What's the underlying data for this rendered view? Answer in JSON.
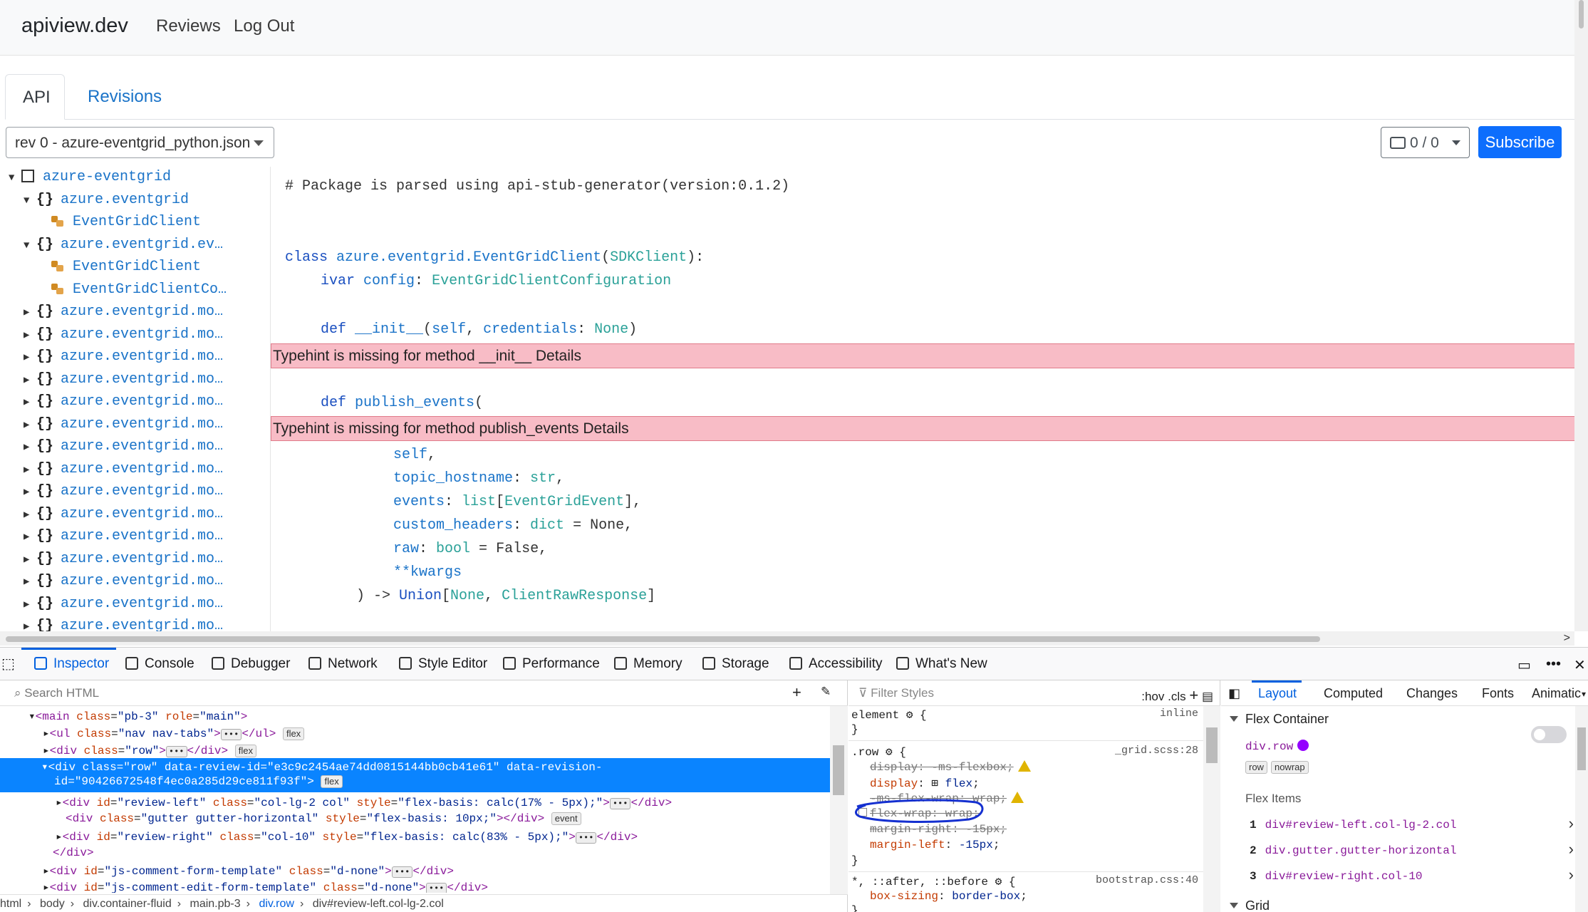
{
  "navbar": {
    "brand": "apiview.dev",
    "links": [
      "Reviews",
      "Log Out"
    ]
  },
  "tabs": [
    "API",
    "Revisions"
  ],
  "toolbar": {
    "revision_select": "rev 0 - azure-eventgrid_python.json",
    "comment_count": "0 / 0",
    "subscribe": "Subscribe"
  },
  "tree": {
    "root": "azure-eventgrid",
    "items": [
      {
        "kind": "ns",
        "label": "azure.eventgrid",
        "expanded": true
      },
      {
        "kind": "class",
        "label": "EventGridClient"
      },
      {
        "kind": "ns",
        "label": "azure.eventgrid.ev…",
        "expanded": true
      },
      {
        "kind": "class",
        "label": "EventGridClient"
      },
      {
        "kind": "class",
        "label": "EventGridClientCo…"
      },
      {
        "kind": "ns",
        "label": "azure.eventgrid.mo…"
      },
      {
        "kind": "ns",
        "label": "azure.eventgrid.mo…"
      },
      {
        "kind": "ns",
        "label": "azure.eventgrid.mo…"
      },
      {
        "kind": "ns",
        "label": "azure.eventgrid.mo…"
      },
      {
        "kind": "ns",
        "label": "azure.eventgrid.mo…"
      },
      {
        "kind": "ns",
        "label": "azure.eventgrid.mo…"
      },
      {
        "kind": "ns",
        "label": "azure.eventgrid.mo…"
      },
      {
        "kind": "ns",
        "label": "azure.eventgrid.mo…"
      },
      {
        "kind": "ns",
        "label": "azure.eventgrid.mo…"
      },
      {
        "kind": "ns",
        "label": "azure.eventgrid.mo…"
      },
      {
        "kind": "ns",
        "label": "azure.eventgrid.mo…"
      },
      {
        "kind": "ns",
        "label": "azure.eventgrid.mo…"
      },
      {
        "kind": "ns",
        "label": "azure.eventgrid.mo…"
      },
      {
        "kind": "ns",
        "label": "azure.eventgrid.mo…"
      },
      {
        "kind": "ns",
        "label": "azure.eventgrid.mo…"
      }
    ]
  },
  "code": {
    "header_comment": "# Package is parsed using api-stub-generator(version:0.1.2)",
    "class_kw": "class",
    "class_name": "azure.eventgrid.EventGridClient",
    "class_base": "SDKClient",
    "ivar_kw": "ivar",
    "ivar_name": "config",
    "ivar_type": "EventGridClientConfiguration",
    "def_kw": "def",
    "init_name": "__init__",
    "init_self": "self",
    "init_param": "credentials",
    "init_type": "None",
    "diag1": "Typehint is missing for method __init__ Details",
    "publish_name": "publish_events",
    "diag2": "Typehint is missing for method publish_events Details",
    "p_self": "self",
    "p_topic": "topic_hostname",
    "p_topic_type": "str",
    "p_events": "events",
    "p_events_type": "list",
    "p_events_inner": "EventGridEvent",
    "p_headers": "custom_headers",
    "p_headers_type": "dict",
    "p_headers_default": "None",
    "p_raw": "raw",
    "p_raw_type": "bool",
    "p_raw_default": "False",
    "p_kwargs": "**kwargs",
    "ret_union": "Union",
    "ret_none": "None",
    "ret_type": "ClientRawResponse"
  },
  "devtools": {
    "tabs": [
      "Inspector",
      "Console",
      "Debugger",
      "Network",
      "Style Editor",
      "Performance",
      "Memory",
      "Storage",
      "Accessibility",
      "What's New"
    ],
    "search_placeholder": "Search HTML",
    "filter_placeholder": "Filter Styles",
    "filter_tools": ":hov  .cls",
    "breadcrumbs": [
      "html",
      "body",
      "div.container-fluid",
      "main.pb-3",
      "div.row",
      "div#review-left.col-lg-2.col"
    ],
    "layout_tabs": [
      "Layout",
      "Computed",
      "Changes",
      "Fonts",
      "Animatic"
    ],
    "flex_container": "Flex Container",
    "flex_selector": "div.row",
    "flex_tags": [
      "row",
      "nowrap"
    ],
    "flex_items_title": "Flex Items",
    "flex_items": [
      "div#review-left.col-lg-2.col",
      "div.gutter.gutter-horizontal",
      "div#review-right.col-10"
    ],
    "grid_title": "Grid"
  }
}
